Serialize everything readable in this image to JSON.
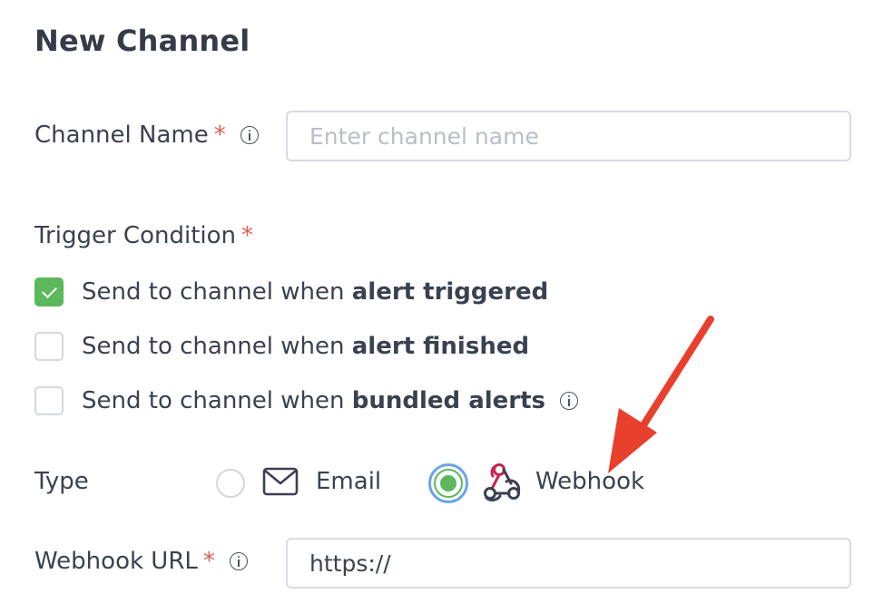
{
  "form": {
    "title": "New Channel",
    "channel_name": {
      "label": "Channel Name",
      "required_mark": "*",
      "placeholder": "Enter channel name",
      "value": ""
    },
    "trigger_condition": {
      "label": "Trigger Condition",
      "required_mark": "*",
      "options": [
        {
          "prefix": "Send to channel when ",
          "bold": "alert triggered",
          "checked": true
        },
        {
          "prefix": "Send to channel when ",
          "bold": "alert finished",
          "checked": false
        },
        {
          "prefix": "Send to channel when ",
          "bold": "bundled alerts",
          "checked": false
        }
      ]
    },
    "type": {
      "label": "Type",
      "options": [
        {
          "label": "Email",
          "icon": "envelope-icon",
          "selected": false
        },
        {
          "label": "Webhook",
          "icon": "webhook-icon",
          "selected": true
        }
      ]
    },
    "webhook_url": {
      "label": "Webhook URL",
      "required_mark": "*",
      "value": "https://"
    }
  },
  "annotation": {
    "arrow_color": "#e8402d",
    "points_to": "Webhook"
  },
  "colors": {
    "accent_green": "#5cb85c",
    "focus_blue": "#6aa3e8",
    "required_red": "#e05b57",
    "webhook_pink": "#c7254e"
  }
}
